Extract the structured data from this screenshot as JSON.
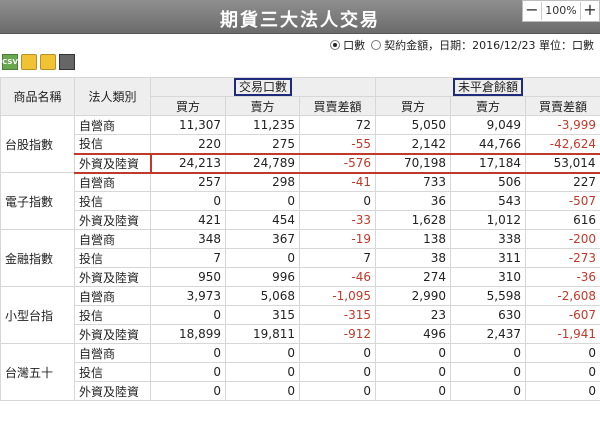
{
  "title": "期貨三大法人交易",
  "zoom": {
    "minus": "−",
    "value": "100%",
    "plus": "+"
  },
  "options": {
    "radio_lots": "口數",
    "radio_amount": "契約金額",
    "date_label": "，日期：2016/12/23 單位：口數"
  },
  "toolbar": {
    "csv": "CSV"
  },
  "headers": {
    "product": "商品名稱",
    "category": "法人類別",
    "group_volume": "交易口數",
    "group_oi": "未平倉餘額",
    "buy": "買方",
    "sell": "賣方",
    "net": "買賣差額"
  },
  "rows": [
    {
      "product": "台股指數",
      "category": "自營商",
      "v": [
        "11,307",
        "11,235",
        "72",
        "5,050",
        "9,049",
        "-3,999"
      ]
    },
    {
      "product": "",
      "category": "投信",
      "v": [
        "220",
        "275",
        "-55",
        "2,142",
        "44,766",
        "-42,624"
      ]
    },
    {
      "product": "",
      "category": "外資及陸資",
      "v": [
        "24,213",
        "24,789",
        "-576",
        "70,198",
        "17,184",
        "53,014"
      ],
      "highlight": true
    },
    {
      "product": "電子指數",
      "category": "自營商",
      "v": [
        "257",
        "298",
        "-41",
        "733",
        "506",
        "227"
      ]
    },
    {
      "product": "",
      "category": "投信",
      "v": [
        "0",
        "0",
        "0",
        "36",
        "543",
        "-507"
      ]
    },
    {
      "product": "",
      "category": "外資及陸資",
      "v": [
        "421",
        "454",
        "-33",
        "1,628",
        "1,012",
        "616"
      ]
    },
    {
      "product": "金融指數",
      "category": "自營商",
      "v": [
        "348",
        "367",
        "-19",
        "138",
        "338",
        "-200"
      ]
    },
    {
      "product": "",
      "category": "投信",
      "v": [
        "7",
        "0",
        "7",
        "38",
        "311",
        "-273"
      ]
    },
    {
      "product": "",
      "category": "外資及陸資",
      "v": [
        "950",
        "996",
        "-46",
        "274",
        "310",
        "-36"
      ]
    },
    {
      "product": "小型台指",
      "category": "自營商",
      "v": [
        "3,973",
        "5,068",
        "-1,095",
        "2,990",
        "5,598",
        "-2,608"
      ]
    },
    {
      "product": "",
      "category": "投信",
      "v": [
        "0",
        "315",
        "-315",
        "23",
        "630",
        "-607"
      ]
    },
    {
      "product": "",
      "category": "外資及陸資",
      "v": [
        "18,899",
        "19,811",
        "-912",
        "496",
        "2,437",
        "-1,941"
      ]
    },
    {
      "product": "台灣五十",
      "category": "自營商",
      "v": [
        "0",
        "0",
        "0",
        "0",
        "0",
        "0"
      ]
    },
    {
      "product": "",
      "category": "投信",
      "v": [
        "0",
        "0",
        "0",
        "0",
        "0",
        "0"
      ]
    },
    {
      "product": "",
      "category": "外資及陸資",
      "v": [
        "0",
        "0",
        "0",
        "0",
        "0",
        "0"
      ]
    }
  ]
}
